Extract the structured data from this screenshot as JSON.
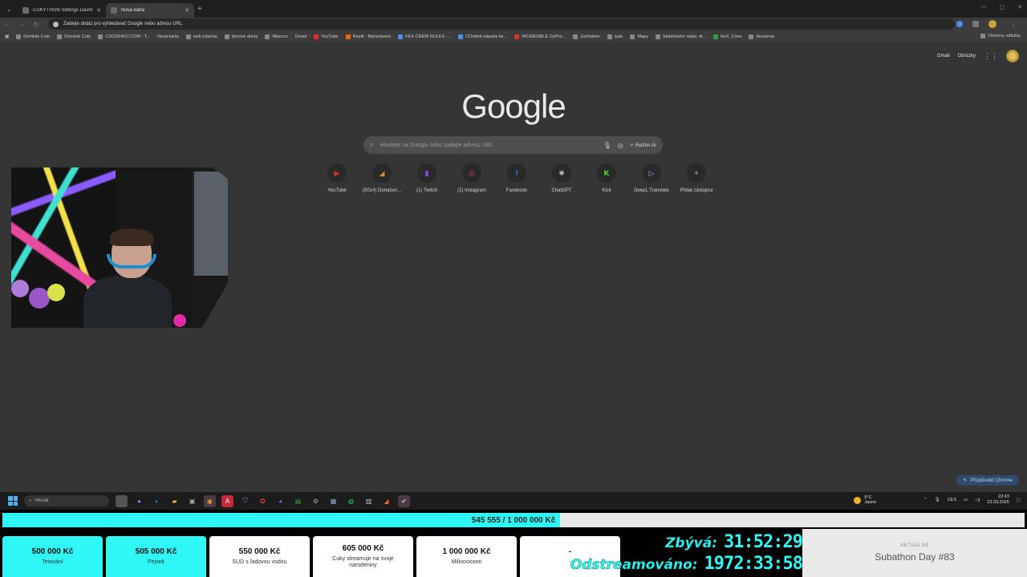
{
  "browser": {
    "tabs": [
      {
        "title": "CUKYTHON Settings Dashboard",
        "active": false
      },
      {
        "title": "Nová karta",
        "active": true
      }
    ],
    "omnibox": {
      "text": "Zadejte dotaz pro vyhledávač Google nebo adresu URL"
    },
    "bookmarks": [
      "Dominik Cukr",
      "Dominik Cukr",
      "CSGOFAST.COM - T...",
      "Nová karta",
      "web zdarma",
      "týmové dresy",
      "iMacros",
      "Gmail",
      "YouTube",
      "Replit - fitenedseed",
      "KEX CREW RULES -...",
      "COntent nápady ke...",
      "INCREDIBLE GoPro...",
      "Začínáme",
      "auto",
      "Mapy",
      "Stabilizační stativ, dr...",
      "KeX_Crew",
      "dovolená"
    ],
    "all_bookmarks": "Všechny záložky"
  },
  "page": {
    "top_links": {
      "gmail": "Gmail",
      "images": "Obrázky"
    },
    "logo": "Google",
    "search": {
      "placeholder": "Hledejte na Googlu nebo zadejte adresu URL",
      "ai_mode": "Režim AI"
    },
    "shortcuts": [
      {
        "label": "YouTube",
        "glyph": "▶",
        "color": "#e52d27"
      },
      {
        "label": "(5014) Donačen...",
        "glyph": "◢",
        "color": "#e08a2a"
      },
      {
        "label": "(1) Twitch",
        "glyph": "▮",
        "color": "#9146ff"
      },
      {
        "label": "(2) Instagram",
        "glyph": "◎",
        "color": "#e1306c"
      },
      {
        "label": "Facebook",
        "glyph": "f",
        "color": "#1877f2"
      },
      {
        "label": "ChatGPT",
        "glyph": "✺",
        "color": "#bbbbbb"
      },
      {
        "label": "Kick",
        "glyph": "K",
        "color": "#53fc18"
      },
      {
        "label": "DeepL Translate",
        "glyph": "▷",
        "color": "#0f2b46"
      },
      {
        "label": "Přidat zástupce",
        "glyph": "+",
        "color": "#2a2a2a"
      }
    ],
    "customize": "Přizpůsobit Chrome"
  },
  "taskbar": {
    "search": "Hledat",
    "weather": {
      "temp": "6°C",
      "condition": "Jasno"
    },
    "lang": "CES",
    "time": "22:43",
    "date": "23.03.2026"
  },
  "overlay": {
    "progress": {
      "text": "545 555 / 1 000 000 Kč",
      "current": 545555,
      "goal": 1000000
    },
    "goals": [
      {
        "amount": "500 000 Kč",
        "desc": "Tetování",
        "done": true
      },
      {
        "amount": "505 000 Kč",
        "desc": "Pejsek",
        "done": true
      },
      {
        "amount": "550 000 Kč",
        "desc": "SUD s ľadovou vodou",
        "done": false
      },
      {
        "amount": "605 000 Kč",
        "desc": "Cuky streamuje na svoje narodeniny",
        "done": false
      },
      {
        "amount": "1 000 000 Kč",
        "desc": "Milioooooon",
        "done": false
      },
      {
        "amount": "-",
        "desc": "-",
        "done": false
      }
    ],
    "timers": {
      "remaining_label": "Zbývá:",
      "remaining_value": "31:52:29",
      "streamed_label": "Odstreamováno:",
      "streamed_value": "1972:33:58"
    },
    "current": {
      "label": "AKTUÁLNE",
      "value": "Subathon Day #83"
    }
  }
}
